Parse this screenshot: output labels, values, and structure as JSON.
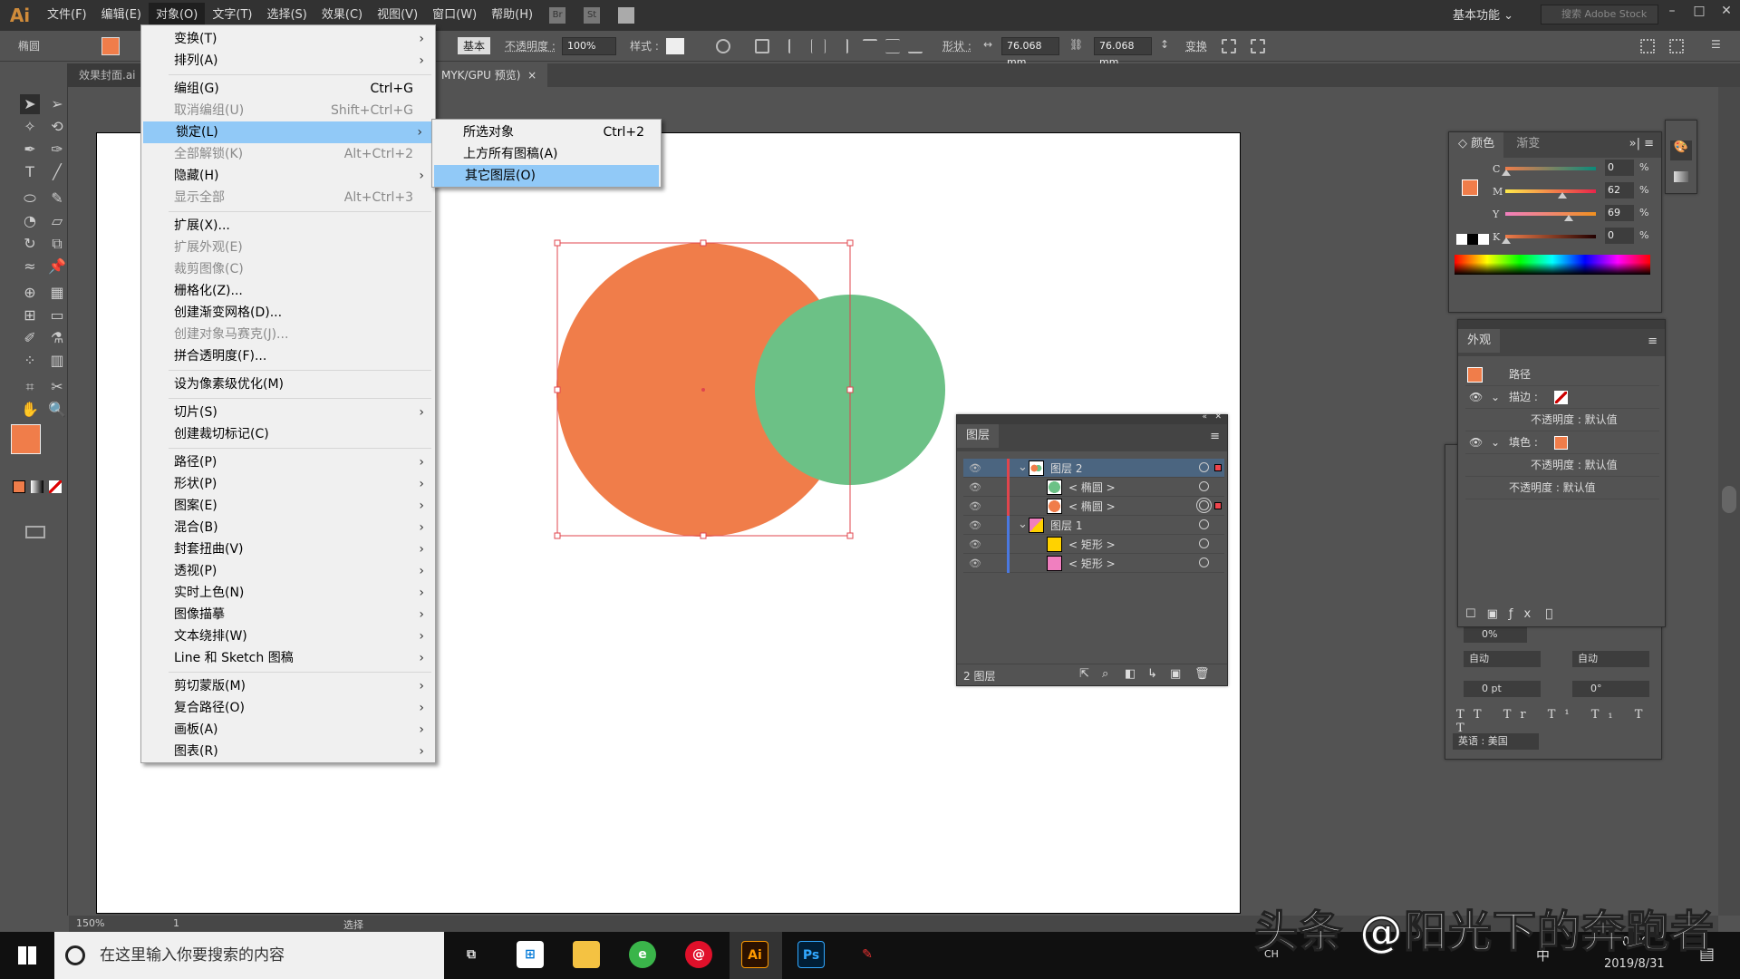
{
  "app": {
    "logo": "Ai",
    "menus": [
      "文件(F)",
      "编辑(E)",
      "对象(O)",
      "文字(T)",
      "选择(S)",
      "效果(C)",
      "视图(V)",
      "窗口(W)",
      "帮助(H)"
    ],
    "active_menu": 2,
    "bridge": "Br",
    "stock": "St",
    "workspace": "基本功能",
    "search_placeholder": "搜索 Adobe Stock"
  },
  "control": {
    "object_type": "椭圆",
    "fill_color": "#f07d4a",
    "stroke_style": "基本",
    "opacity_label": "不透明度 :",
    "opacity": "100%",
    "style_label": "样式 :",
    "shape_label": "形状 :",
    "width": "76.068 mm",
    "height": "76.068 mm",
    "transform": "变换"
  },
  "tabs": [
    {
      "label": "效果封面.ai"
    },
    {
      "label": "MYK/GPU 预览)",
      "close": "×"
    }
  ],
  "object_menu": [
    {
      "label": "变换(T)",
      "sub": true
    },
    {
      "label": "排列(A)",
      "sub": true
    },
    {
      "sep": true
    },
    {
      "label": "编组(G)",
      "shortcut": "Ctrl+G"
    },
    {
      "label": "取消编组(U)",
      "shortcut": "Shift+Ctrl+G",
      "disabled": true
    },
    {
      "label": "锁定(L)",
      "sub": true,
      "highlight": true
    },
    {
      "label": "全部解锁(K)",
      "shortcut": "Alt+Ctrl+2",
      "disabled": true
    },
    {
      "label": "隐藏(H)",
      "sub": true
    },
    {
      "label": "显示全部",
      "shortcut": "Alt+Ctrl+3",
      "disabled": true
    },
    {
      "sep": true
    },
    {
      "label": "扩展(X)..."
    },
    {
      "label": "扩展外观(E)",
      "disabled": true
    },
    {
      "label": "裁剪图像(C)",
      "disabled": true
    },
    {
      "label": "栅格化(Z)..."
    },
    {
      "label": "创建渐变网格(D)..."
    },
    {
      "label": "创建对象马赛克(J)...",
      "disabled": true
    },
    {
      "label": "拼合透明度(F)..."
    },
    {
      "sep": true
    },
    {
      "label": "设为像素级优化(M)"
    },
    {
      "sep": true
    },
    {
      "label": "切片(S)",
      "sub": true
    },
    {
      "label": "创建裁切标记(C)"
    },
    {
      "sep": true
    },
    {
      "label": "路径(P)",
      "sub": true
    },
    {
      "label": "形状(P)",
      "sub": true
    },
    {
      "label": "图案(E)",
      "sub": true
    },
    {
      "label": "混合(B)",
      "sub": true
    },
    {
      "label": "封套扭曲(V)",
      "sub": true
    },
    {
      "label": "透视(P)",
      "sub": true
    },
    {
      "label": "实时上色(N)",
      "sub": true
    },
    {
      "label": "图像描摹",
      "sub": true
    },
    {
      "label": "文本绕排(W)",
      "sub": true
    },
    {
      "label": "Line 和 Sketch 图稿",
      "sub": true
    },
    {
      "sep": true
    },
    {
      "label": "剪切蒙版(M)",
      "sub": true
    },
    {
      "label": "复合路径(O)",
      "sub": true
    },
    {
      "label": "画板(A)",
      "sub": true
    },
    {
      "label": "图表(R)",
      "sub": true
    }
  ],
  "lock_submenu": [
    {
      "label": "所选对象",
      "shortcut": "Ctrl+2"
    },
    {
      "label": "上方所有图稿(A)"
    },
    {
      "label": "其它图层(O)",
      "highlight": true
    }
  ],
  "canvas": {
    "orange": "#f07d4a",
    "green": "#6cc186",
    "selection": "#e0454d"
  },
  "layers": {
    "title": "图层",
    "footer": "2 图层",
    "rows": [
      {
        "name": "图层 2",
        "level": 0,
        "bar": "#e0454d",
        "thumb": "layer2",
        "selected": true,
        "expanded": true
      },
      {
        "name": "< 椭圆 >",
        "level": 1,
        "bar": "#e0454d",
        "thumb": "#6cc186"
      },
      {
        "name": "< 椭圆 >",
        "level": 1,
        "bar": "#e0454d",
        "thumb": "#f07d4a",
        "targeted": true
      },
      {
        "name": "图层 1",
        "level": 0,
        "bar": "#4a78e0",
        "thumb": "layer1",
        "expanded": true
      },
      {
        "name": "< 矩形 >",
        "level": 1,
        "bar": "#4a78e0",
        "thumb": "#ffd200"
      },
      {
        "name": "< 矩形 >",
        "level": 1,
        "bar": "#4a78e0",
        "thumb": "#f07fbf"
      }
    ]
  },
  "color": {
    "tabs": [
      "颜色",
      "渐变"
    ],
    "channels": [
      {
        "label": "C",
        "value": "0"
      },
      {
        "label": "M",
        "value": "62"
      },
      {
        "label": "Y",
        "value": "69"
      },
      {
        "label": "K",
        "value": "0"
      }
    ],
    "unit": "%"
  },
  "appearance": {
    "title": "外观",
    "path": "路径",
    "stroke": "描边 :",
    "fill": "填色 :",
    "opacity": "不透明度 : 默认值"
  },
  "character": {
    "tracking": "0%",
    "leading1": "自动",
    "leading2": "自动",
    "baseline": "0 pt",
    "rotate": "0°",
    "language": "英语 : 美国"
  },
  "status": {
    "zoom": "150%",
    "artboard": "1",
    "tool": "选择"
  },
  "taskbar": {
    "search": "在这里输入你要搜索的内容",
    "ime_lang": "CH",
    "ime": "中",
    "date": "2019/8/31",
    "time": "0:26"
  },
  "watermark": "头条 @阳光下的奔跑者"
}
